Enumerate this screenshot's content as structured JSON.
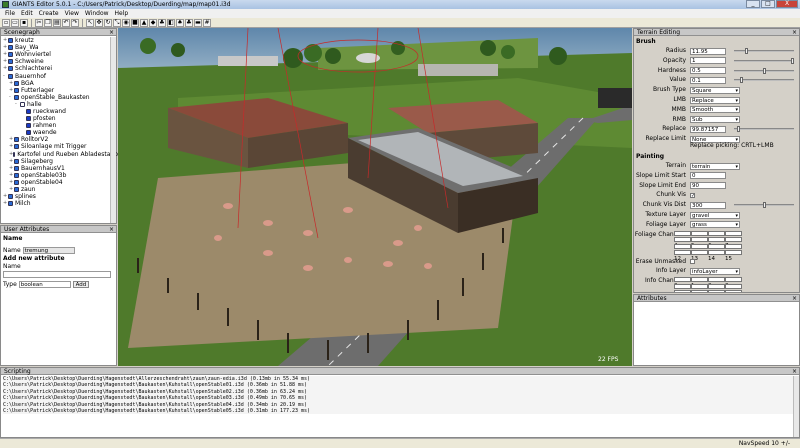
{
  "window": {
    "title": "GIANTS Editor 5.0.1 - C:/Users/Patrick/Desktop/Duerding/map/map01.i3d",
    "controls": [
      "_",
      "□",
      "X"
    ]
  },
  "menu": [
    "File",
    "Edit",
    "Create",
    "View",
    "Window",
    "Help"
  ],
  "scenegraph": {
    "title": "Scenegraph",
    "items": [
      {
        "label": "kreutz",
        "depth": 0,
        "expander": "+",
        "color": "#2a6ad4"
      },
      {
        "label": "Bay_Wa",
        "depth": 0,
        "expander": "+",
        "color": "#2a6ad4"
      },
      {
        "label": "Wohnviertel",
        "depth": 0,
        "expander": "+",
        "color": "#2a6ad4"
      },
      {
        "label": "Schweine",
        "depth": 0,
        "expander": "+",
        "color": "#2a6ad4"
      },
      {
        "label": "Schlachterei",
        "depth": 0,
        "expander": "+",
        "color": "#2a6ad4"
      },
      {
        "label": "Bauernhof",
        "depth": 0,
        "expander": "-",
        "color": "#2a6ad4"
      },
      {
        "label": "BGA",
        "depth": 1,
        "expander": "+",
        "color": "#2a6ad4"
      },
      {
        "label": "Futterlager",
        "depth": 1,
        "expander": "+",
        "color": "#2a6ad4"
      },
      {
        "label": "openStable_Baukasten",
        "depth": 1,
        "expander": "-",
        "color": "#2a6ad4"
      },
      {
        "label": "halle",
        "depth": 2,
        "expander": "-",
        "color": "#ffffff"
      },
      {
        "label": "rueckwand",
        "depth": 3,
        "expander": "",
        "color": "#1a3ac4"
      },
      {
        "label": "pfosten",
        "depth": 3,
        "expander": "",
        "color": "#1a3ac4"
      },
      {
        "label": "rahmen",
        "depth": 3,
        "expander": "",
        "color": "#1a3ac4"
      },
      {
        "label": "waende",
        "depth": 3,
        "expander": "",
        "color": "#1a3ac4"
      },
      {
        "label": "RolltorV2",
        "depth": 1,
        "expander": "+",
        "color": "#2a6ad4"
      },
      {
        "label": "Siloanlage mit Trigger",
        "depth": 1,
        "expander": "+",
        "color": "#2a6ad4"
      },
      {
        "label": "Kartofel und Rueben Abladestation",
        "depth": 1,
        "expander": "+",
        "color": "#2a6ad4"
      },
      {
        "label": "Silageberg",
        "depth": 1,
        "expander": "+",
        "color": "#2a6ad4"
      },
      {
        "label": "BauernhausV1",
        "depth": 1,
        "expander": "+",
        "color": "#2a6ad4"
      },
      {
        "label": "openStable03b",
        "depth": 1,
        "expander": "+",
        "color": "#2a6ad4"
      },
      {
        "label": "openStable04",
        "depth": 1,
        "expander": "+",
        "color": "#2a6ad4"
      },
      {
        "label": "zaun",
        "depth": 1,
        "expander": "+",
        "color": "#2a6ad4"
      },
      {
        "label": "splines",
        "depth": 0,
        "expander": "+",
        "color": "#2a6ad4"
      },
      {
        "label": "Milch",
        "depth": 0,
        "expander": "+",
        "color": "#2a6ad4"
      }
    ]
  },
  "user_attributes": {
    "title": "User Attributes",
    "name_header": "Name",
    "name_label": "Name",
    "name_value": "tremung",
    "add_header": "Add new attribute",
    "new_name_label": "Name",
    "type_label": "Type",
    "type_value": "boolean",
    "add_button": "Add"
  },
  "viewport": {
    "fps": "22 FPS"
  },
  "terrain_editing": {
    "title": "Terrain Editing",
    "brush_header": "Brush",
    "radius_label": "Radius",
    "radius_value": "11.95",
    "radius_level": 0.2,
    "opacity_label": "Opacity",
    "opacity_value": "1",
    "opacity_level": 1.0,
    "hardness_label": "Hardness",
    "hardness_value": "0.5",
    "hardness_level": 0.5,
    "value_label": "Value",
    "value_value": "0.1",
    "value_level": 0.1,
    "brush_type_label": "Brush Type",
    "brush_type_value": "Square",
    "lmb_label": "LMB",
    "lmb_value": "Replace",
    "mmb_label": "MMB",
    "mmb_value": "Smooth",
    "rmb_label": "RMB",
    "rmb_value": "Sub",
    "replace_label": "Replace",
    "replace_value": "99.87157",
    "replace_limit_label": "Replace Limit",
    "replace_limit_value": "None",
    "replace_picking": "Replace picking: CRTL+LMB",
    "painting_header": "Painting",
    "terrain_label": "Terrain",
    "terrain_value": "terrain",
    "slope_start_label": "Slope Limit Start",
    "slope_start_value": "0",
    "slope_end_label": "Slope Limit End",
    "slope_end_value": "90",
    "chunk_vis_label": "Chunk Vis",
    "chunk_vis_checked": true,
    "chunk_vis_dist_label": "Chunk Vis Dist",
    "chunk_vis_dist_value": "300",
    "texture_layer_label": "Texture Layer",
    "texture_layer_value": "gravel",
    "foliage_layer_label": "Foliage Layer",
    "foliage_layer_value": "grass",
    "foliage_channels_label": "Foliage Channels",
    "foliage_channels": [
      [
        "0",
        "1",
        "2",
        "3"
      ],
      [
        "4",
        "5",
        "6",
        "7"
      ],
      [
        "8",
        "9",
        "10",
        "11"
      ],
      [
        "12",
        "13",
        "14",
        "15"
      ]
    ],
    "erase_unmasked_label": "Erase Unmasked",
    "info_layer_label": "Info Layer",
    "info_layer_value": "infoLayer",
    "info_channels_label": "Info Channels",
    "info_channels": [
      [
        "0",
        "1",
        "2",
        "3"
      ],
      [
        "4",
        "5",
        "6",
        "7"
      ],
      [
        "8",
        "9",
        "10",
        "11"
      ],
      [
        "12",
        "13",
        "14",
        "15"
      ]
    ],
    "erase_unmasked_2_label": "Erase Unmasked"
  },
  "attributes": {
    "title": "Attributes"
  },
  "scripting": {
    "title": "Scripting",
    "lines": [
      "C:\\Users\\Patrick\\Desktop\\Duerding\\Hagenstedt\\Allerzeschendraht\\zaun\\zaun-edia.i3d (0.13mb in 55.34 ms)",
      "C:\\Users\\Patrick\\Desktop\\Duerding\\Hagenstedt\\Baukasten\\Kuhstall\\openStable01.i3d (0.36mb in 51.88 ms)",
      "C:\\Users\\Patrick\\Desktop\\Duerding\\Hagenstedt\\Baukasten\\Kuhstall\\openStable02.i3d (0.36mb in 63.24 ms)",
      "C:\\Users\\Patrick\\Desktop\\Duerding\\Hagenstedt\\Baukasten\\Kuhstall\\openStable03.i3d (0.49mb in 70.65 ms)",
      "C:\\Users\\Patrick\\Desktop\\Duerding\\Hagenstedt\\Baukasten\\Kuhstall\\openStable04.i3d (0.34mb in 20.19 ms)",
      "C:\\Users\\Patrick\\Desktop\\Duerding\\Hagenstedt\\Baukasten\\Kuhstall\\openStable05.i3d (0.31mb in 177.23 ms)"
    ]
  },
  "status": {
    "navspeed": "NavSpeed 10 +/-"
  }
}
